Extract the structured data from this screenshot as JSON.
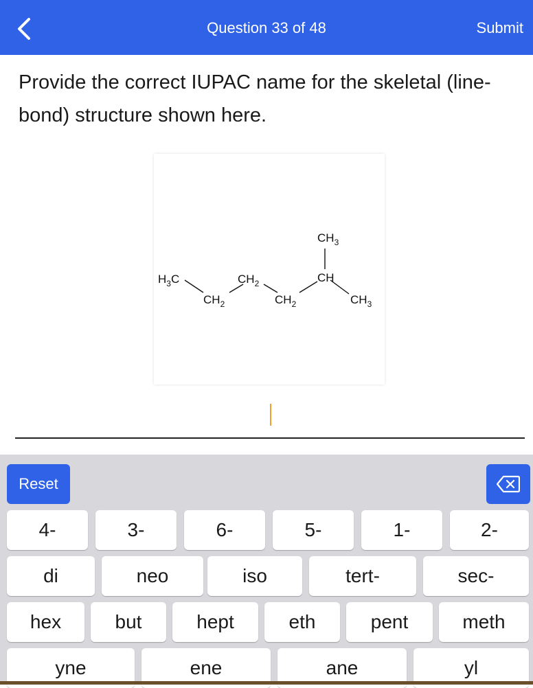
{
  "header": {
    "title": "Question 33 of 48",
    "submit_label": "Submit",
    "background": "#2f62e6"
  },
  "question": {
    "text": "Provide the correct IUPAC name for the skeletal (line-bond) structure shown here."
  },
  "structure": {
    "labels": {
      "h3c": "H3C",
      "ch2_a": "CH2",
      "ch2_b": "CH2",
      "ch2_c": "CH2",
      "ch": "CH",
      "ch3_top": "CH3",
      "ch3_right": "CH3"
    }
  },
  "keyboard": {
    "reset_label": "Reset",
    "row1": [
      "4-",
      "3-",
      "6-",
      "5-",
      "1-",
      "2-"
    ],
    "row2": [
      "di",
      "neo",
      "iso",
      "tert-",
      "sec-"
    ],
    "row3": [
      "hex",
      "but",
      "hept",
      "eth",
      "pent",
      "meth"
    ],
    "row4": [
      "yne",
      "ene",
      "ane",
      "yl"
    ]
  }
}
